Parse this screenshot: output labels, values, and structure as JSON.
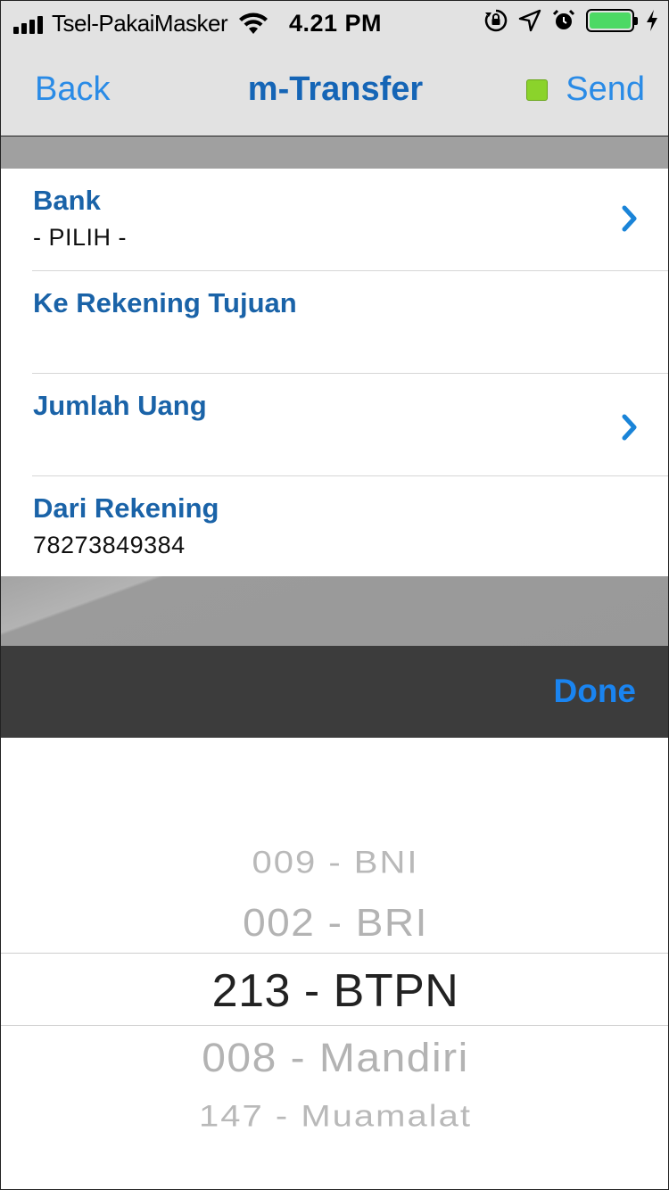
{
  "status_bar": {
    "carrier": "Tsel-PakaiMasker",
    "time": "4.21 PM",
    "battery_color": "#4cd964"
  },
  "nav": {
    "back_label": "Back",
    "title": "m-Transfer",
    "send_label": "Send",
    "send_indicator_color": "#8bd32b"
  },
  "form": {
    "rows": [
      {
        "label": "Bank",
        "value": "- PILIH -",
        "has_chevron": true
      },
      {
        "label": "Ke Rekening Tujuan",
        "value": "",
        "has_chevron": false
      },
      {
        "label": "Jumlah Uang",
        "value": "",
        "has_chevron": true
      },
      {
        "label": "Dari Rekening",
        "value": "78273849384",
        "has_chevron": false
      }
    ]
  },
  "picker": {
    "done_label": "Done",
    "options": [
      "009 - BNI",
      "002 - BRI",
      "213 - BTPN",
      "008 - Mandiri",
      "147 - Muamalat"
    ],
    "selected": "213 - BTPN"
  },
  "colors": {
    "accent": "#2a8be6",
    "label_blue": "#1a63a8",
    "toolbar": "#3c3c3c"
  },
  "icons": [
    "signal-icon",
    "wifi-icon",
    "orientation-lock-icon",
    "location-icon",
    "alarm-icon",
    "battery-icon",
    "charging-icon",
    "chevron-right-icon"
  ]
}
